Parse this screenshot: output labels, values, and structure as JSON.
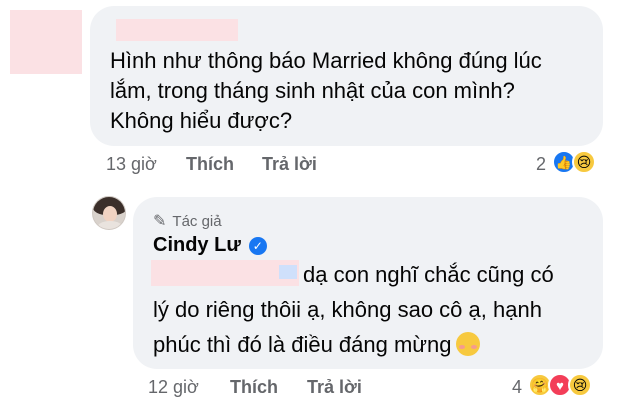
{
  "comment1": {
    "lines": [
      "Hình như thông báo Married không đúng lúc",
      "lắm, trong tháng sinh nhật của con mình?",
      "Không hiểu được?"
    ],
    "time": "13 giờ",
    "like": "Thích",
    "reply": "Trả lời",
    "reaction_count": "2",
    "reaction_icons": [
      "like-icon",
      "sad-icon"
    ]
  },
  "comment2": {
    "author_badge": "Tác giả",
    "author_name": "Cindy Lư",
    "lines": [
      "dạ con nghĩ chắc cũng có",
      "lý do riêng thôii ạ, không sao cô ạ, hạnh",
      "phúc thì đó là điều đáng mừng"
    ],
    "time": "12 giờ",
    "like": "Thích",
    "reply": "Trả lời",
    "reaction_count": "4",
    "reaction_icons": [
      "care-icon",
      "love-icon",
      "sad-icon"
    ]
  },
  "colors": {
    "bubble": "#f0f2f5",
    "meta_text": "#65676b",
    "blur": "#fbe1e4",
    "accent": "#1877f2"
  }
}
